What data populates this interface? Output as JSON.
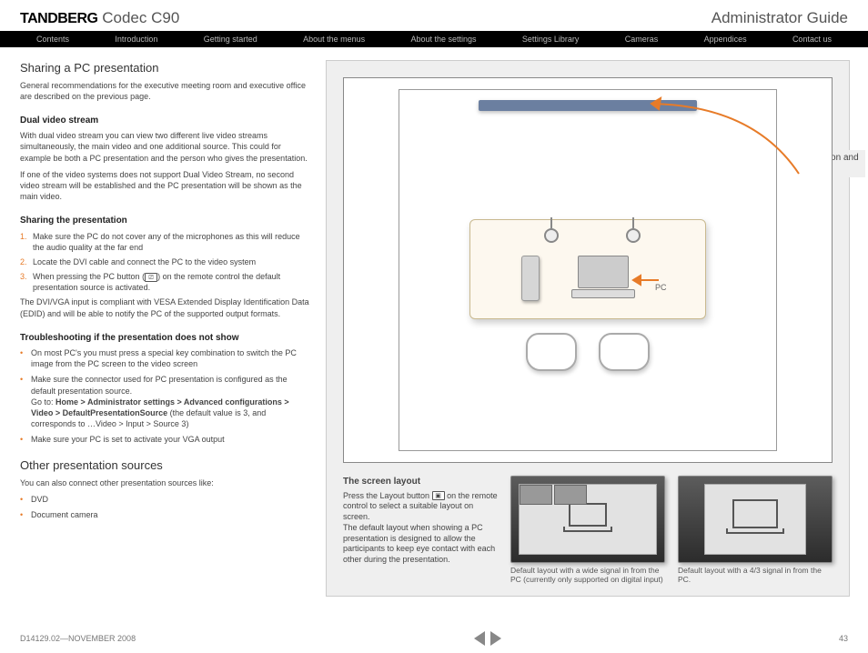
{
  "header": {
    "brand_bold": "TANDBERG",
    "brand_light": "Codec C90",
    "doc_title": "Administrator Guide"
  },
  "nav": [
    "Contents",
    "Introduction",
    "Getting started",
    "About the menus",
    "About the settings",
    "Settings Library",
    "Cameras",
    "Appendices",
    "Contact us"
  ],
  "left": {
    "h2": "Sharing a PC presentation",
    "intro": "General recommendations for the executive meeting room and executive office are described on the previous page.",
    "dual_h": "Dual video stream",
    "dual_p1": "With dual video stream you can view two different live video streams simultaneously, the main video and one additional source. This could for example be both a PC presentation and the person who gives the presentation.",
    "dual_p2": "If one of the video systems does not support Dual Video Stream, no second video stream will be established and the PC presentation will be shown as the main video.",
    "share_h": "Sharing the presentation",
    "share_li1": "Make sure the PC do not cover any of the microphones as this will reduce the audio quality at the far end",
    "share_li2": "Locate the DVI cable and connect the PC to the video system",
    "share_li3_a": "When pressing the PC button (",
    "share_li3_b": ") on the remote control the default presentation source is activated.",
    "edid": "The DVI/VGA input is compliant with VESA Extended Display Identification Data (EDID) and will be able to notify the PC of the supported output formats.",
    "trouble_h": "Troubleshooting if the presentation does not show",
    "t_li1": "On most PC's you must press a special key combination to switch the PC image from the PC screen to the video screen",
    "t_li2_a": "Make sure the connector used for PC presentation is configured as the default presentation source.",
    "t_li2_b": "Go to: ",
    "t_li2_path": "Home > Administrator settings > Advanced configurations > Video > DefaultPresentationSource",
    "t_li2_c": " (the default value is 3, and corresponds to …Video > Input > Source 3)",
    "t_li3": "Make sure your PC is set to activate your VGA output",
    "other_h": "Other presentation sources",
    "other_p": "You can also connect other presentation sources like:",
    "other_li1": "DVD",
    "other_li2": "Document camera"
  },
  "diagram": {
    "callout": "Shows the PC presentation and the participants",
    "pc_label": "PC"
  },
  "layout": {
    "h": "The  screen layout",
    "p1_a": "Press the Layout button ",
    "p1_b": " on the remote control to select a suitable layout on screen.",
    "p2": "The default layout when showing a PC presentation is designed to allow the participants to keep eye contact with each other during the presentation.",
    "cap1": "Default layout with a wide signal in from the PC (currently only supported on digital input)",
    "cap2": "Default layout with a 4/3 signal in from the PC."
  },
  "footer": {
    "docnum": "D14129.02—NOVEMBER 2008",
    "page": "43"
  }
}
